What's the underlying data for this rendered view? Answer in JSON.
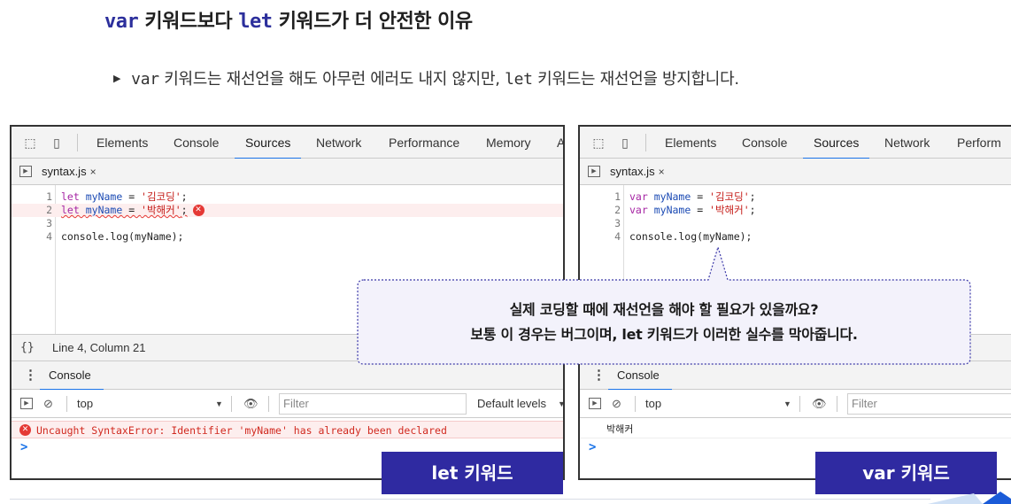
{
  "slide": {
    "title": {
      "kw1": "var",
      "mid1": " 키워드보다 ",
      "kw2": "let",
      "mid2": " 키워드가 더 안전한 이유"
    },
    "bullet": {
      "kw1": "var",
      "t1": " 키워드는 재선언을 해도 아무런 에러도 내지 않지만, ",
      "kw2": "let",
      "t2": " 키워드는 재선언을 방지합니다."
    }
  },
  "left_panel": {
    "tabs": [
      "Elements",
      "Console",
      "Sources",
      "Network",
      "Performance",
      "Memory",
      "A"
    ],
    "active_tab": "Sources",
    "file": "syntax.js",
    "close": "×",
    "code_lines": [
      {
        "n": "1",
        "kw": "let",
        "name": "myName",
        "op": " = ",
        "str": "'김코딩'",
        "end": ";"
      },
      {
        "n": "2",
        "kw": "let",
        "name": "myName",
        "op": " = ",
        "str": "'박해커'",
        "end": ";"
      },
      {
        "n": "3"
      },
      {
        "n": "4",
        "text": "console.log(myName);"
      }
    ],
    "error_mark": "✕",
    "status_braces": "{}",
    "status_position": "Line 4, Column 21",
    "console_title": "Console",
    "context": "top",
    "filter_placeholder": "Filter",
    "levels": "Default levels",
    "error_message": "Uncaught SyntaxError: Identifier 'myName' has already been declared",
    "prompt": ">",
    "label": "let 키워드"
  },
  "right_panel": {
    "tabs": [
      "Elements",
      "Console",
      "Sources",
      "Network",
      "Perform"
    ],
    "active_tab": "Sources",
    "file": "syntax.js",
    "close": "×",
    "code_lines": [
      {
        "n": "1",
        "kw": "var",
        "name": "myName",
        "op": " = ",
        "str": "'김코딩'",
        "end": ";"
      },
      {
        "n": "2",
        "kw": "var",
        "name": "myName",
        "op": " = ",
        "str": "'박해커'",
        "end": ";"
      },
      {
        "n": "3"
      },
      {
        "n": "4",
        "text": "console.log(myName);"
      }
    ],
    "console_title": "Console",
    "context": "top",
    "filter_placeholder": "Filter",
    "log_output": "박해커",
    "prompt": ">",
    "label": "var 키워드"
  },
  "callout": {
    "line1": "실제 코딩할 때에 재선언을 해야 할 필요가 있을까요?",
    "line2": "보통 이 경우는 버그이며, let 키워드가 이러한 실수를 막아줍니다."
  },
  "colors": {
    "keyword_title": "#2c2f9c",
    "label_bg": "#2f2aa1",
    "active_tab": "#1a73e8",
    "error": "#e53935",
    "callout_fill": "#f3f2fb",
    "callout_border": "#3b38a8"
  }
}
